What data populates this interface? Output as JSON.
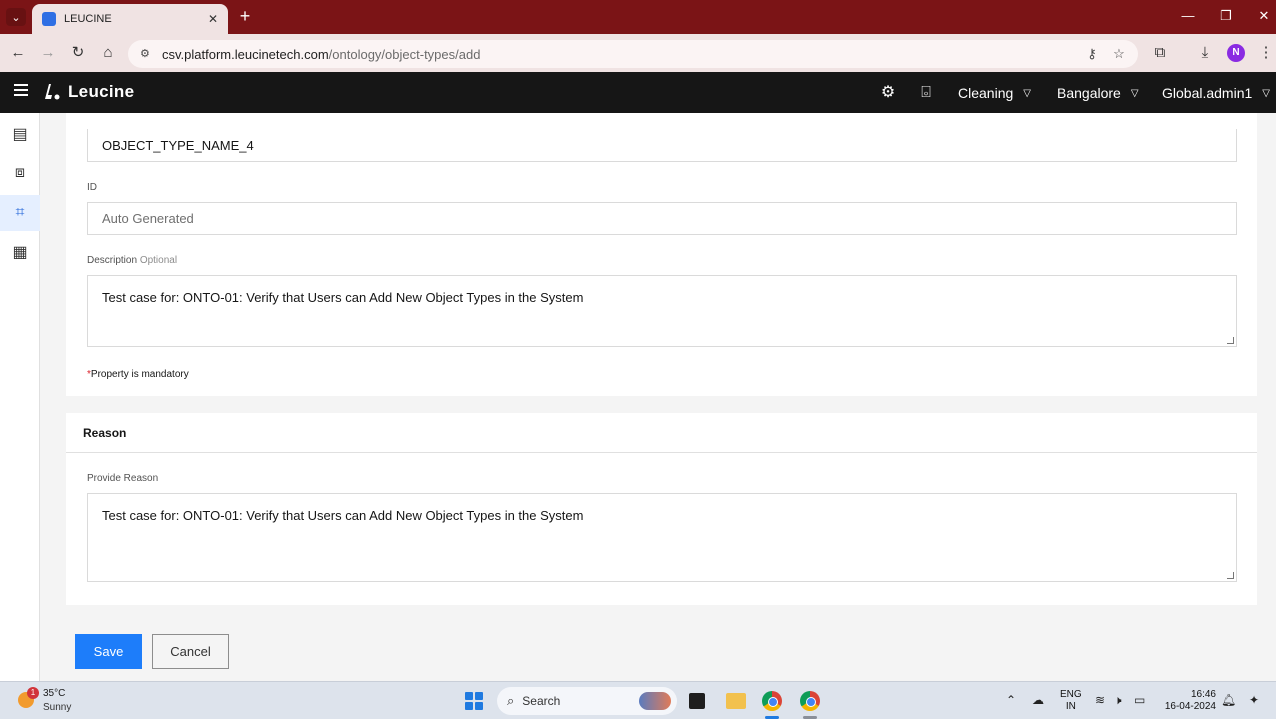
{
  "browser": {
    "tab_title": "LEUCINE",
    "tab_close": "✕",
    "new_tab": "+",
    "url_host": "csv.platform.leucinetech.com",
    "url_path": "/ontology/object-types/add",
    "profile_initial": "N"
  },
  "app": {
    "brand": "Leucine",
    "menus": {
      "facility_type": "Cleaning",
      "location": "Bangalore",
      "user": "Global.admin1"
    }
  },
  "form": {
    "name_value": "OBJECT_TYPE_NAME_4",
    "id_label": "ID",
    "id_placeholder": "Auto Generated",
    "description_label": "Description",
    "description_optional": "Optional",
    "description_value": "Test case for: ONTO-01: Verify that Users can Add New Object Types in the System",
    "mandatory_star": "*",
    "mandatory_note": "Property is mandatory"
  },
  "reason": {
    "heading": "Reason",
    "label": "Provide Reason",
    "value": "Test case for: ONTO-01: Verify that Users can Add New Object Types in the System"
  },
  "actions": {
    "save": "Save",
    "cancel": "Cancel"
  },
  "taskbar": {
    "weather_badge": "1",
    "weather_temp": "35°C",
    "weather_desc": "Sunny",
    "search_label": "Search",
    "lang_line1": "ENG",
    "lang_line2": "IN",
    "time": "16:46",
    "date": "16-04-2024"
  }
}
